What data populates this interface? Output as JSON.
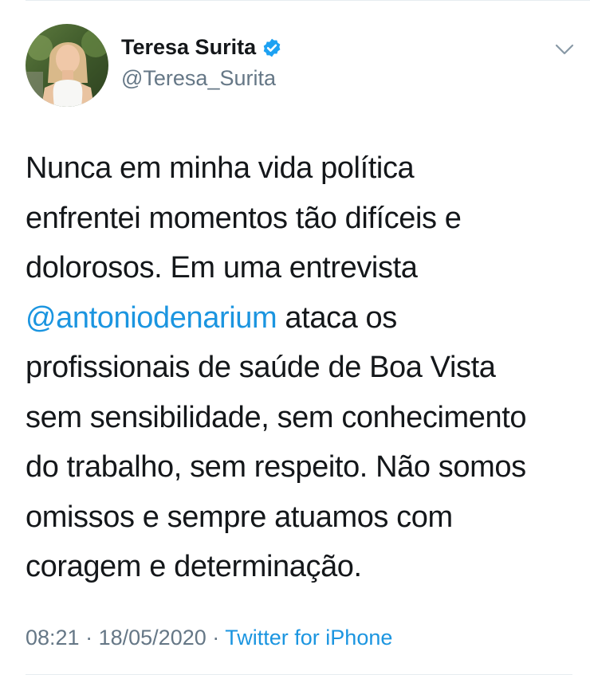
{
  "author": {
    "display_name": "Teresa Surita",
    "handle": "@Teresa_Surita",
    "avatar_icon": "profile-photo",
    "verified_icon": "verified-badge-icon",
    "verified_color": "#1da1f2"
  },
  "tweet": {
    "lines": [
      {
        "text": "Nunca em minha vida política"
      },
      {
        "text": "enfrentei momentos tão difíceis e"
      },
      {
        "text": "dolorosos. Em uma entrevista"
      },
      {
        "mention": "@antoniodenarium",
        "text": " ataca os"
      },
      {
        "text": "profissionais de saúde de Boa Vista"
      },
      {
        "text": "sem sensibilidade, sem conhecimento"
      },
      {
        "text": "do trabalho, sem respeito. Não somos"
      },
      {
        "text": "omissos e sempre atuamos com"
      },
      {
        "text": "coragem e determinação."
      }
    ]
  },
  "meta": {
    "time": "08:21",
    "date": "18/05/2020",
    "separator": "·",
    "source": "Twitter for iPhone"
  },
  "colors": {
    "link": "#1b95e0",
    "secondary_text": "#657786",
    "primary_text": "#14171a"
  },
  "menu_icon": "chevron-down-icon"
}
